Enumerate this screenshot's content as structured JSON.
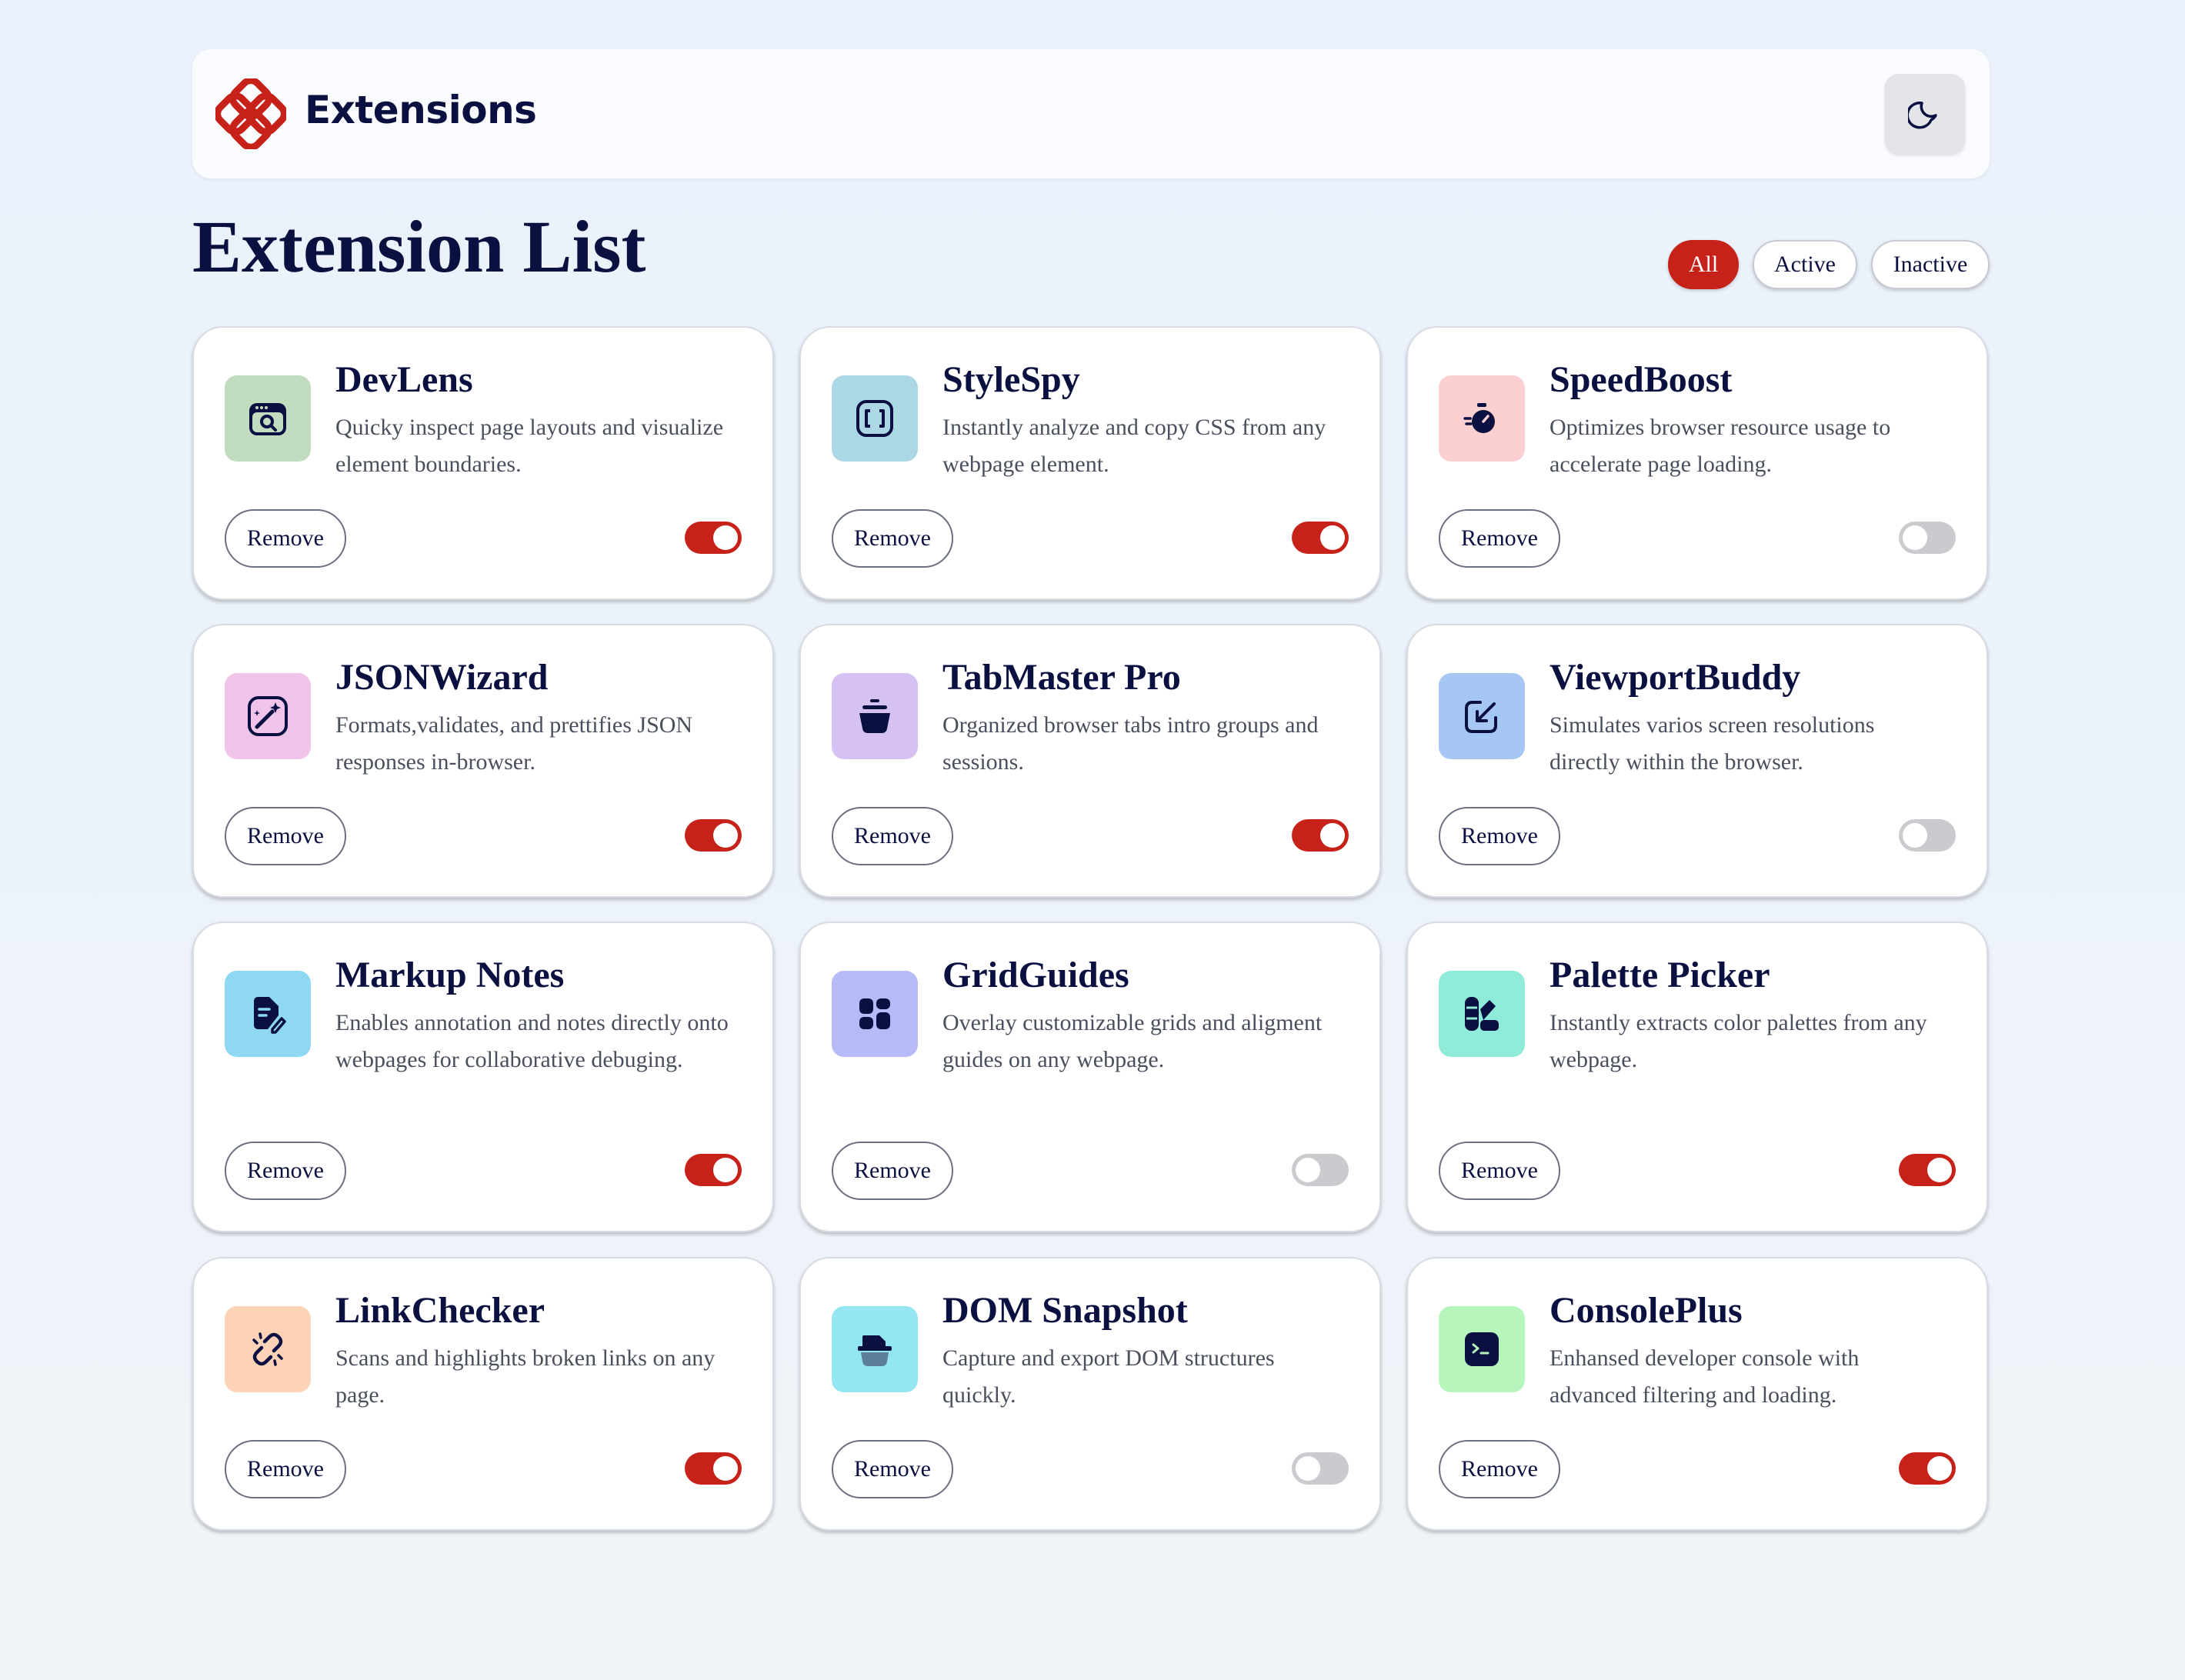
{
  "app": {
    "brand": "Extensions",
    "logo_color": "#c7221a",
    "theme_icon": "moon-icon"
  },
  "page_title": "Extension List",
  "filters": [
    {
      "label": "All",
      "selected": true
    },
    {
      "label": "Active",
      "selected": false
    },
    {
      "label": "Inactive",
      "selected": false
    }
  ],
  "colors": {
    "accent": "#c7221a",
    "text_primary": "#0a1040",
    "toggle_off": "#c9cbcf"
  },
  "remove_label": "Remove",
  "extensions": [
    {
      "name": "DevLens",
      "description": "Quicky inspect page layouts and visualize element boundaries.",
      "active": true,
      "icon": "inspect-browser-icon",
      "icon_bg": "#c2dcc0"
    },
    {
      "name": "StyleSpy",
      "description": "Instantly analyze and copy CSS from any webpage element.",
      "active": true,
      "icon": "brackets-icon",
      "icon_bg": "#acd8e6"
    },
    {
      "name": "SpeedBoost",
      "description": "Optimizes browser resource usage to accelerate page loading.",
      "active": false,
      "icon": "stopwatch-icon",
      "icon_bg": "#fcd0d0"
    },
    {
      "name": "JSONWizard",
      "description": "Formats,validates, and prettifies JSON responses in-browser.",
      "active": true,
      "icon": "magic-wand-icon",
      "icon_bg": "#f0c4e8"
    },
    {
      "name": "TabMaster Pro",
      "description": "Organized browser tabs intro groups and sessions.",
      "active": true,
      "icon": "tab-stack-icon",
      "icon_bg": "#d6c2f2"
    },
    {
      "name": "ViewportBuddy",
      "description": "Simulates varios screen resolutions directly within the browser.",
      "active": false,
      "icon": "resize-arrow-icon",
      "icon_bg": "#a6c6f4"
    },
    {
      "name": "Markup Notes",
      "description": "Enables annotation and notes directly onto webpages for collaborative debuging.",
      "active": true,
      "icon": "note-pen-icon",
      "icon_bg": "#8fd8f4"
    },
    {
      "name": "GridGuides",
      "description": "Overlay customizable grids and aligment guides on any webpage.",
      "active": false,
      "icon": "grid-layout-icon",
      "icon_bg": "#b8baf8"
    },
    {
      "name": "Palette Picker",
      "description": "Instantly extracts color palettes from any webpage.",
      "active": true,
      "icon": "palette-icon",
      "icon_bg": "#8eecd8"
    },
    {
      "name": "LinkChecker",
      "description": "Scans and highlights broken links on any page.",
      "active": true,
      "icon": "broken-link-icon",
      "icon_bg": "#fdd3b8"
    },
    {
      "name": "DOM Snapshot",
      "description": "Capture and export DOM structures quickly.",
      "active": false,
      "icon": "snapshot-icon",
      "icon_bg": "#94e6f2"
    },
    {
      "name": "ConsolePlus",
      "description": "Enhansed developer console with advanced filtering and loading.",
      "active": true,
      "icon": "terminal-icon",
      "icon_bg": "#b6f6bc"
    }
  ]
}
